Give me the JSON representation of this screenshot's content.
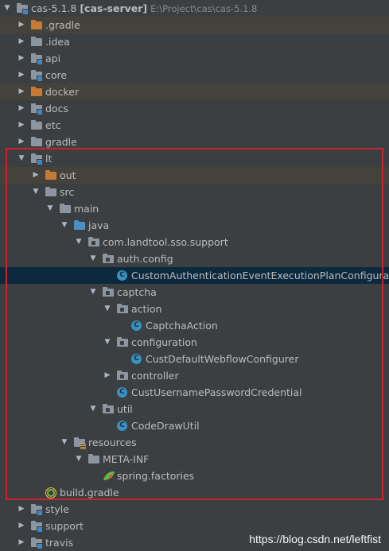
{
  "root": {
    "name": "cas-5.1.8",
    "module": "[cas-server]",
    "path": "E:\\Project\\cas\\cas-5.1.8"
  },
  "items": [
    {
      "label": "cas-5.1.8",
      "depth": 0,
      "arrow": "open",
      "icon": "module-folder"
    },
    {
      "label": ".gradle",
      "depth": 1,
      "arrow": "closed",
      "icon": "orange-folder",
      "excluded": true
    },
    {
      "label": ".idea",
      "depth": 1,
      "arrow": "closed",
      "icon": "folder"
    },
    {
      "label": "api",
      "depth": 1,
      "arrow": "closed",
      "icon": "module-folder"
    },
    {
      "label": "core",
      "depth": 1,
      "arrow": "closed",
      "icon": "module-folder"
    },
    {
      "label": "docker",
      "depth": 1,
      "arrow": "closed",
      "icon": "orange-folder",
      "excluded": true
    },
    {
      "label": "docs",
      "depth": 1,
      "arrow": "closed",
      "icon": "module-folder"
    },
    {
      "label": "etc",
      "depth": 1,
      "arrow": "closed",
      "icon": "folder"
    },
    {
      "label": "gradle",
      "depth": 1,
      "arrow": "closed",
      "icon": "folder"
    },
    {
      "label": "lt",
      "depth": 1,
      "arrow": "open",
      "icon": "module-folder"
    },
    {
      "label": "out",
      "depth": 2,
      "arrow": "closed",
      "icon": "orange-folder",
      "excluded": true
    },
    {
      "label": "src",
      "depth": 2,
      "arrow": "open",
      "icon": "folder"
    },
    {
      "label": "main",
      "depth": 3,
      "arrow": "open",
      "icon": "folder"
    },
    {
      "label": "java",
      "depth": 4,
      "arrow": "open",
      "icon": "source-folder"
    },
    {
      "label": "com.landtool.sso.support",
      "depth": 5,
      "arrow": "open",
      "icon": "package"
    },
    {
      "label": "auth.config",
      "depth": 6,
      "arrow": "open",
      "icon": "package"
    },
    {
      "label": "CustomAuthenticationEventExecutionPlanConfiguration",
      "depth": 7,
      "arrow": "none",
      "icon": "class",
      "selected": true
    },
    {
      "label": "captcha",
      "depth": 6,
      "arrow": "open",
      "icon": "package"
    },
    {
      "label": "action",
      "depth": 7,
      "arrow": "open",
      "icon": "package"
    },
    {
      "label": "CaptchaAction",
      "depth": 8,
      "arrow": "none",
      "icon": "class"
    },
    {
      "label": "configuration",
      "depth": 7,
      "arrow": "open",
      "icon": "package"
    },
    {
      "label": "CustDefaultWebflowConfigurer",
      "depth": 8,
      "arrow": "none",
      "icon": "class"
    },
    {
      "label": "controller",
      "depth": 7,
      "arrow": "closed",
      "icon": "package"
    },
    {
      "label": "CustUsernamePasswordCredential",
      "depth": 7,
      "arrow": "none",
      "icon": "class"
    },
    {
      "label": "util",
      "depth": 6,
      "arrow": "open",
      "icon": "package"
    },
    {
      "label": "CodeDrawUtil",
      "depth": 7,
      "arrow": "none",
      "icon": "class"
    },
    {
      "label": "resources",
      "depth": 4,
      "arrow": "open",
      "icon": "resource-folder"
    },
    {
      "label": "META-INF",
      "depth": 5,
      "arrow": "open",
      "icon": "folder"
    },
    {
      "label": "spring.factories",
      "depth": 6,
      "arrow": "none",
      "icon": "spring"
    },
    {
      "label": "build.gradle",
      "depth": 2,
      "arrow": "none",
      "icon": "gradle"
    },
    {
      "label": "style",
      "depth": 1,
      "arrow": "closed",
      "icon": "module-folder"
    },
    {
      "label": "support",
      "depth": 1,
      "arrow": "closed",
      "icon": "module-folder"
    },
    {
      "label": "travis",
      "depth": 1,
      "arrow": "closed",
      "icon": "module-folder"
    }
  ],
  "class_icon_letter": "C",
  "highlight_color": "#c8232c",
  "watermark": "https://blog.csdn.net/leftfist"
}
